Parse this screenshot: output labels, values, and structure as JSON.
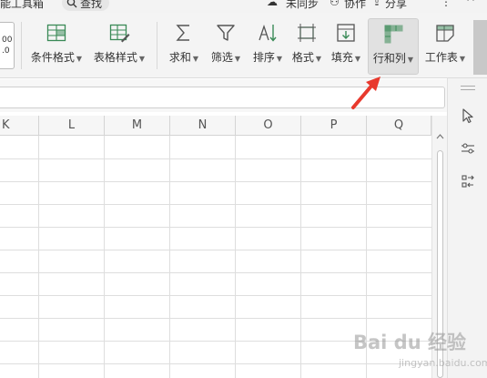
{
  "topbar": {
    "title_fragment": "能工具箱",
    "search_label": "查找",
    "sync_label": "未同步",
    "collab_label": "协作",
    "share_label": "分享",
    "more_label": "⋮",
    "collapse_label": "^"
  },
  "ribbon": {
    "cut_top": "00",
    "cut_bottom": ".0",
    "buttons": [
      {
        "label": "条件格式",
        "icon": "conditional-format-icon",
        "dropdown": true
      },
      {
        "label": "表格样式",
        "icon": "table-style-icon",
        "dropdown": true
      },
      {
        "label": "求和",
        "icon": "sum-icon",
        "dropdown": true
      },
      {
        "label": "筛选",
        "icon": "filter-icon",
        "dropdown": true
      },
      {
        "label": "排序",
        "icon": "sort-icon",
        "dropdown": true
      },
      {
        "label": "格式",
        "icon": "format-icon",
        "dropdown": true
      },
      {
        "label": "填充",
        "icon": "fill-icon",
        "dropdown": true
      },
      {
        "label": "行和列",
        "icon": "rows-columns-icon",
        "dropdown": true,
        "active": true
      },
      {
        "label": "工作表",
        "icon": "worksheet-icon",
        "dropdown": true
      }
    ]
  },
  "grid": {
    "columns": [
      "K",
      "L",
      "M",
      "N",
      "O",
      "P",
      "Q"
    ]
  },
  "watermark": {
    "text": "Bai du 经验",
    "sub": "jingyan.baidu.com"
  },
  "colors": {
    "ribbon_bg": "#f4f4f4",
    "icon_green": "#3a8a57",
    "icon_gray": "#555555",
    "annotation_red": "#e8392d",
    "grid_line": "#dedede"
  }
}
